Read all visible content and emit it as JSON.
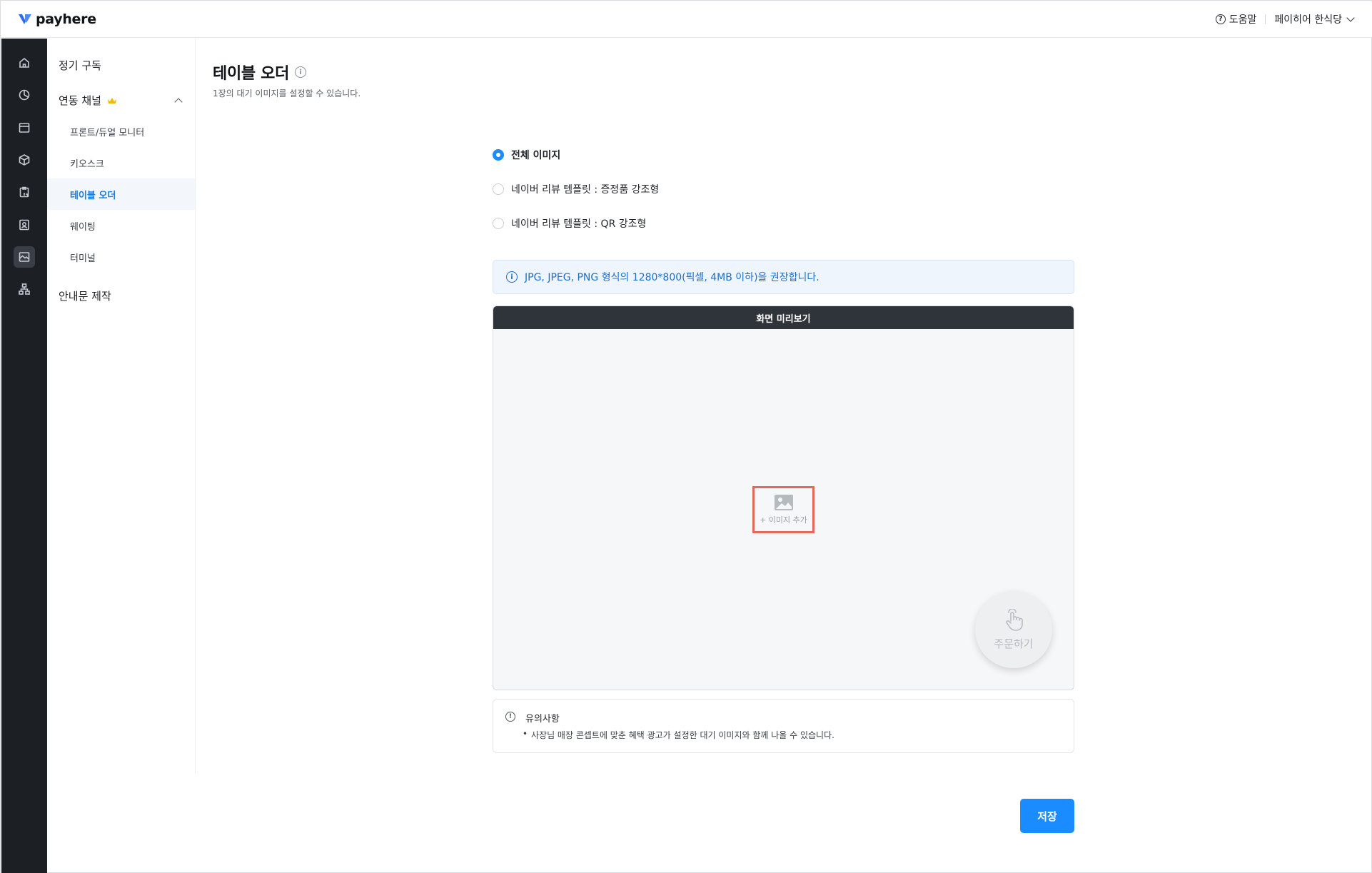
{
  "header": {
    "logo_text": "payhere",
    "help_label": "도움말",
    "store_name": "페이히어 한식당"
  },
  "rail": {
    "items": [
      {
        "icon": "home-icon"
      },
      {
        "icon": "pie-chart-icon"
      },
      {
        "icon": "card-icon"
      },
      {
        "icon": "box-icon"
      },
      {
        "icon": "clipboard-icon"
      },
      {
        "icon": "contact-icon"
      },
      {
        "icon": "image-frame-icon",
        "active": true
      },
      {
        "icon": "org-chart-icon"
      }
    ]
  },
  "submenu": {
    "subscription": "정기 구독",
    "channels": "연동 채널",
    "items": [
      "프론트/듀얼 모니터",
      "키오스크",
      "테이블 오더",
      "웨이팅",
      "터미널"
    ],
    "active_item": "테이블 오더",
    "notice_make": "안내문 제작"
  },
  "main": {
    "title": "테이블 오더",
    "description": "1장의 대기 이미지를 설정할 수 있습니다.",
    "options": [
      {
        "label": "전체 이미지",
        "checked": true
      },
      {
        "label": "네이버 리뷰 템플릿 : 증정품 강조형",
        "checked": false
      },
      {
        "label": "네이버 리뷰 템플릿 : QR 강조형",
        "checked": false
      }
    ],
    "notice": "JPG, JPEG, PNG 형식의 1280*800(픽셀, 4MB 이하)을 권장합니다.",
    "preview": {
      "title": "화면 미리보기",
      "add_image": "+ 이미지 추가",
      "order_button": "주문하기"
    },
    "caution": {
      "title": "유의사항",
      "items": [
        "사장님 매장 콘셉트에 맞춘 혜택 광고가 설정한 대기 이미지와 함께 나올 수 있습니다."
      ]
    },
    "save_label": "저장"
  },
  "colors": {
    "accent": "#1a8cff",
    "rail_bg": "#1c1f24",
    "highlight_border": "#e5695a"
  }
}
